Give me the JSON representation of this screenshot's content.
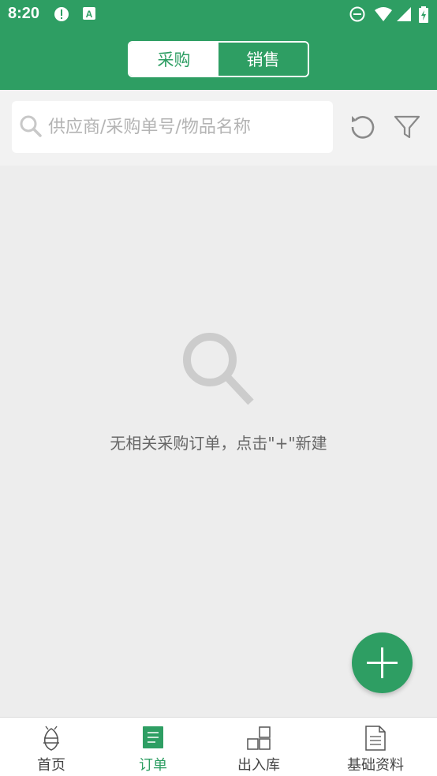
{
  "status_bar": {
    "time": "8:20",
    "icons": [
      "alert-icon",
      "app-a-icon",
      "dnd-icon",
      "wifi-icon",
      "signal-icon",
      "battery-icon"
    ]
  },
  "header": {
    "tabs": [
      {
        "label": "采购",
        "active": true
      },
      {
        "label": "销售",
        "active": false
      }
    ]
  },
  "search": {
    "placeholder": "供应商/采购单号/物品名称",
    "value": ""
  },
  "empty_state": {
    "icon": "search-icon",
    "message": "无相关采购订单，点击\"+\"新建"
  },
  "fab": {
    "icon": "plus-icon"
  },
  "bottom_nav": {
    "items": [
      {
        "label": "首页",
        "icon": "home-icon",
        "active": false
      },
      {
        "label": "订单",
        "icon": "order-icon",
        "active": true
      },
      {
        "label": "出入库",
        "icon": "warehouse-icon",
        "active": false
      },
      {
        "label": "基础资料",
        "icon": "document-icon",
        "active": false
      }
    ]
  },
  "colors": {
    "primary": "#2e9e63",
    "background": "#ededed",
    "text_muted": "#666666"
  }
}
